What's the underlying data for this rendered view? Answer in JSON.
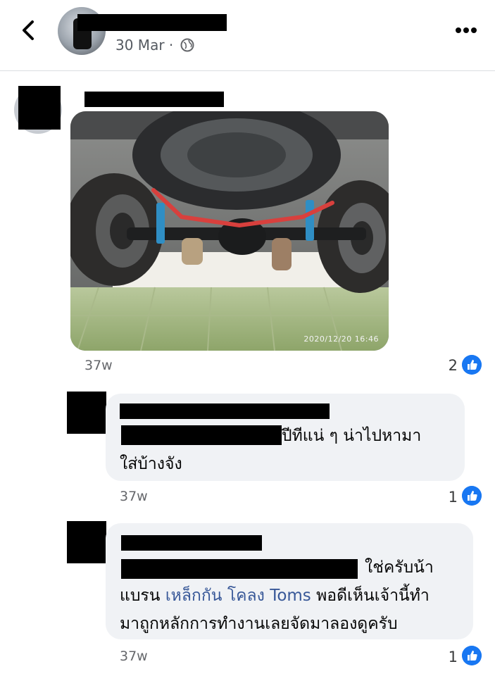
{
  "header": {
    "date": "30 Mar",
    "separator": "·"
  },
  "comment1": {
    "time": "37w",
    "likes": "2",
    "photo_timestamp": "2020/12/20 16:46"
  },
  "reply1": {
    "text_end": "ปีทีแน่ ๆ   น่าไปหามา",
    "line2": "ใส่บ้างจัง",
    "time": "37w",
    "likes": "1"
  },
  "reply2": {
    "text_end": "ใช่ครับน้า",
    "line2_prefix": "แบรน ",
    "line2_link": "เหล็กกัน โคลง Toms",
    "line2_suffix": " พอดีเห็นเจ้านี้ทำ",
    "line3": "มาถูกหลักการทำงานเลยจัดมาลองดูครับ",
    "time": "37w",
    "likes": "1"
  },
  "colors": {
    "accent": "#1877f2",
    "link": "#385898",
    "bubble": "#f0f2f5",
    "meta": "#65676b"
  },
  "icons": [
    "back-chevron-icon",
    "globe-icon",
    "more-options-icon",
    "like-thumb-icon"
  ]
}
